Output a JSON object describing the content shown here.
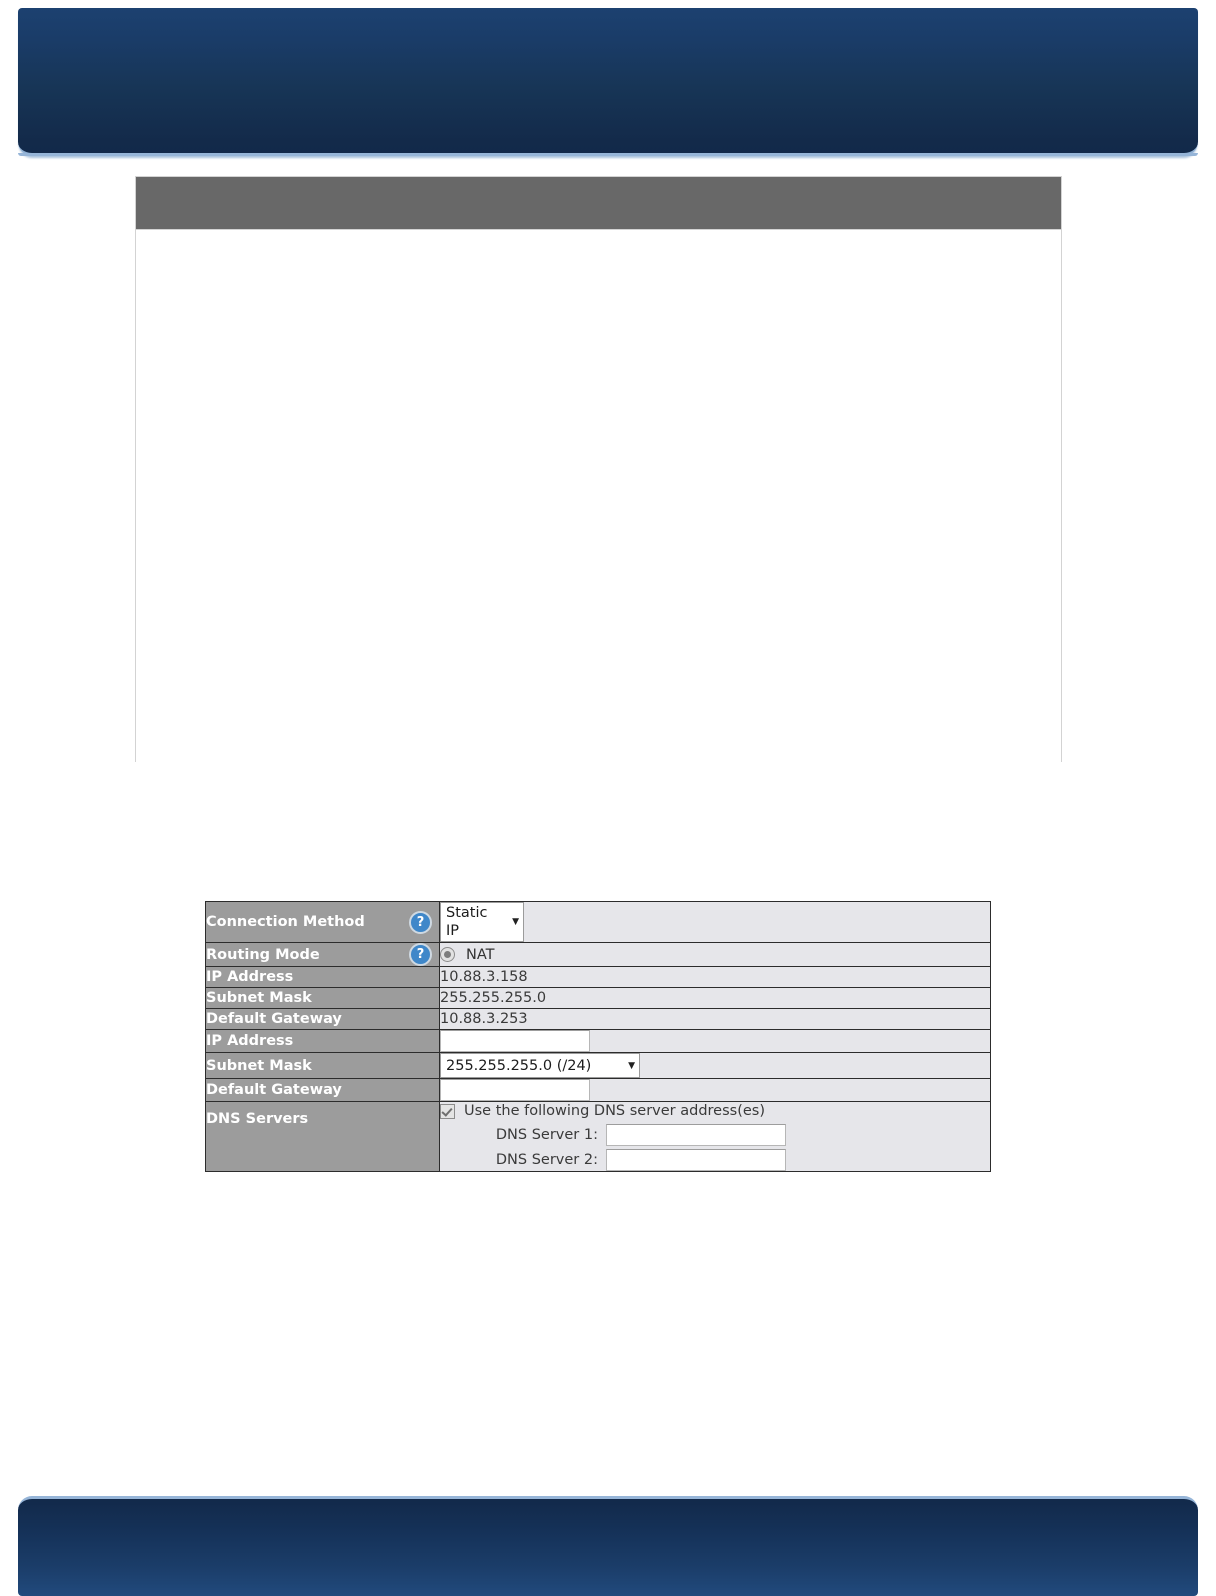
{
  "header": {
    "banner_label": "",
    "accent_color": "#1c4170"
  },
  "panel": {
    "title": "",
    "body_text": ""
  },
  "settings": {
    "rows": [
      {
        "label": "Connection Method",
        "has_help": true,
        "control": "select",
        "value": "Static IP"
      },
      {
        "label": "Routing Mode",
        "has_help": true,
        "control": "radio",
        "value": "NAT"
      },
      {
        "label": "IP Address",
        "has_help": false,
        "control": "text-static",
        "value": "10.88.3.158"
      },
      {
        "label": "Subnet Mask",
        "has_help": false,
        "control": "text-static",
        "value": "255.255.255.0"
      },
      {
        "label": "Default Gateway",
        "has_help": false,
        "control": "text-static",
        "value": "10.88.3.253"
      },
      {
        "label": "IP Address",
        "has_help": false,
        "control": "input",
        "value": ""
      },
      {
        "label": "Subnet Mask",
        "has_help": false,
        "control": "select",
        "value": "255.255.255.0 (/24)"
      },
      {
        "label": "Default Gateway",
        "has_help": false,
        "control": "input",
        "value": ""
      },
      {
        "label": "DNS Servers",
        "has_help": false,
        "control": "dns",
        "value": ""
      }
    ],
    "dns": {
      "checkbox_label": "Use the following DNS server address(es)",
      "checkbox_checked": true,
      "server1_label": "DNS Server 1:",
      "server1_value": "",
      "server2_label": "DNS Server 2:",
      "server2_value": ""
    },
    "help_glyph": "?",
    "caret_glyph": "▼",
    "colors": {
      "label_bg": "#9c9c9c",
      "value_bg": "#e6e6ea",
      "help_blue": "#3f87c9",
      "border": "#2c2c2c"
    }
  },
  "footer": {
    "banner_label": ""
  }
}
